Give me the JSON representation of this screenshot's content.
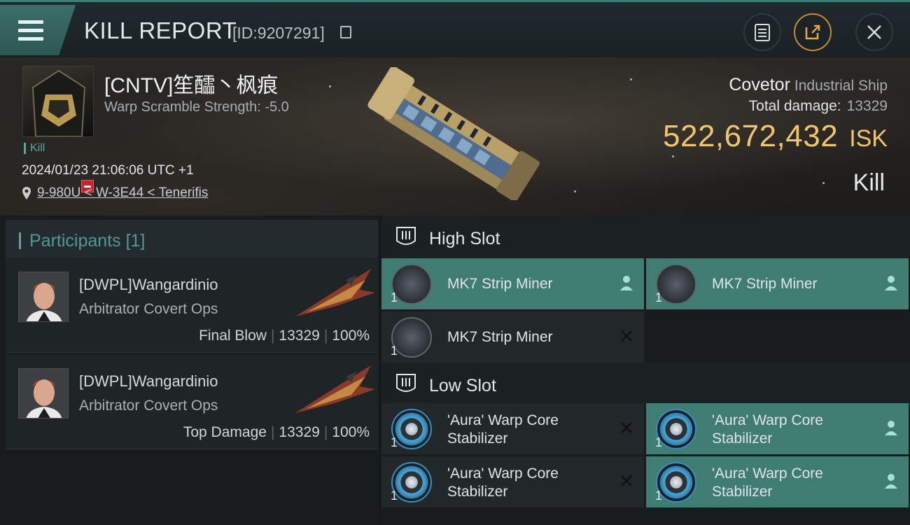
{
  "header": {
    "title": "KILL REPORT",
    "report_id": "[ID:9207291]"
  },
  "victim": {
    "name": "[CNTV]笙醽丶枫痕",
    "warp_scramble": "Warp Scramble Strength: -5.0",
    "type_tag": "Kill",
    "datetime": "2024/01/23 21:06:06 UTC +1",
    "location": "9-980U < W-3E44 < Tenerifis"
  },
  "ship": {
    "name": "Covetor",
    "class": "Industrial Ship",
    "total_damage_label": "Total damage:",
    "total_damage": "13329",
    "isk_value": "522,672,432",
    "isk_unit": "ISK",
    "result": "Kill"
  },
  "participants": {
    "title": "Participants",
    "count": "[1]",
    "rows": [
      {
        "name": "[DWPL]Wangardinio",
        "ship": "Arbitrator Covert Ops",
        "role": "Final Blow",
        "damage": "13329",
        "percent": "100%"
      },
      {
        "name": "[DWPL]Wangardinio",
        "ship": "Arbitrator Covert Ops",
        "role": "Top Damage",
        "damage": "13329",
        "percent": "100%"
      }
    ]
  },
  "slots": {
    "high": {
      "title": "High Slot",
      "modules": [
        {
          "name": "MK7 Strip Miner",
          "qty": "1",
          "status": "dropped"
        },
        {
          "name": "MK7 Strip Miner",
          "qty": "1",
          "status": "dropped"
        },
        {
          "name": "MK7 Strip Miner",
          "qty": "1",
          "status": "destroyed"
        }
      ]
    },
    "low": {
      "title": "Low Slot",
      "modules": [
        {
          "name_line1": "'Aura' Warp Core",
          "name_line2": "Stabilizer",
          "qty": "1",
          "status": "destroyed"
        },
        {
          "name_line1": "'Aura' Warp Core",
          "name_line2": "Stabilizer",
          "qty": "1",
          "status": "dropped"
        },
        {
          "name_line1": "'Aura' Warp Core",
          "name_line2": "Stabilizer",
          "qty": "1",
          "status": "destroyed"
        },
        {
          "name_line1": "'Aura' Warp Core",
          "name_line2": "Stabilizer",
          "qty": "1",
          "status": "dropped"
        }
      ]
    }
  },
  "colors": {
    "accent_teal": "#3f7d73",
    "isk_gold": "#f0c668",
    "negative_red": "#c8232a"
  },
  "icons": {
    "menu": "hamburger-icon",
    "copy": "copy-icon",
    "notes": "clipboard-icon",
    "share": "share-icon",
    "close": "close-icon",
    "location": "pin-icon",
    "slot": "slot-shield-icon",
    "dropped": "person-icon",
    "destroyed": "x-icon"
  }
}
